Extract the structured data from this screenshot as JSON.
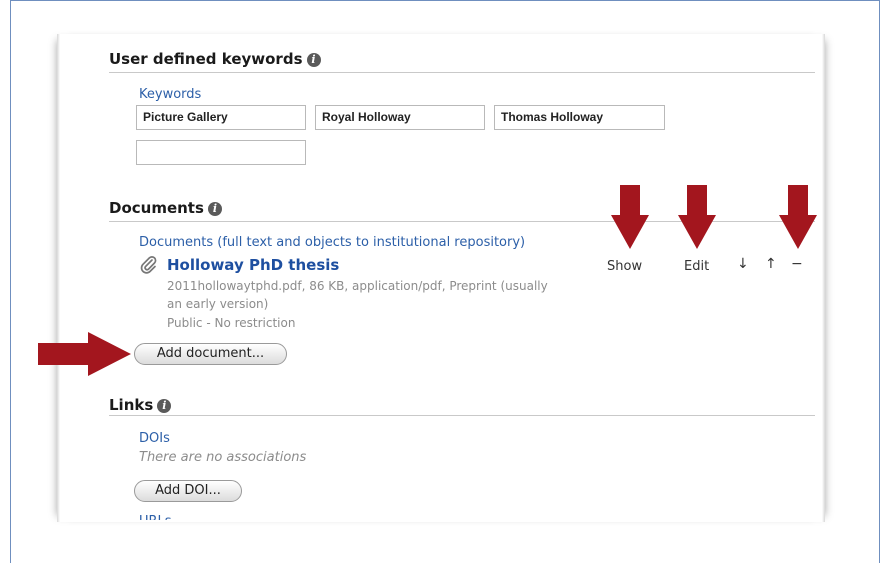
{
  "keywords_section": {
    "heading": "User defined keywords",
    "field_label": "Keywords",
    "values": [
      "Picture Gallery",
      "Royal Holloway",
      "Thomas Holloway",
      ""
    ]
  },
  "documents_section": {
    "heading": "Documents",
    "field_label": "Documents (full text and objects to institutional repository)",
    "document": {
      "title": "Holloway PhD thesis",
      "meta_line1": "2011hollowaytphd.pdf, 86 KB, application/pdf, Preprint (usually",
      "meta_line2": "an early version)",
      "access": "Public - No restriction"
    },
    "actions": {
      "show": "Show",
      "edit": "Edit",
      "move_down": "↓",
      "move_up": "↑",
      "remove": "−"
    },
    "add_button": "Add document..."
  },
  "links_section": {
    "heading": "Links",
    "field_label": "DOIs",
    "empty_note": "There are no associations",
    "add_button": "Add DOI...",
    "next_label": "URLs"
  },
  "colors": {
    "annotation_arrow": "#a3161e",
    "link_blue": "#2c5fa8",
    "title_blue": "#1e4fa0"
  },
  "icons": {
    "info": "info-icon",
    "attachment": "paperclip-icon",
    "arrows": "red-annotation-arrow"
  }
}
